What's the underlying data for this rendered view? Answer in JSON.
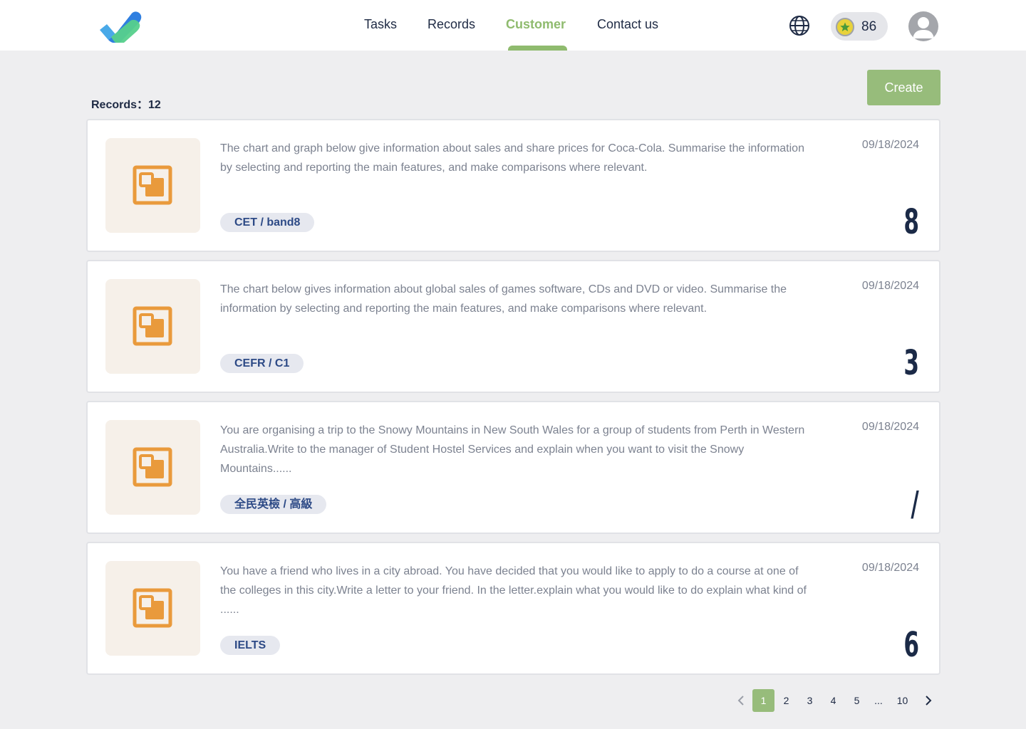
{
  "header": {
    "nav": [
      {
        "label": "Tasks",
        "active": false
      },
      {
        "label": "Records",
        "active": false
      },
      {
        "label": "Customer",
        "active": true
      },
      {
        "label": "Contact us",
        "active": false
      }
    ],
    "coins": "86"
  },
  "toolbar": {
    "records_label": "Records：12",
    "create_label": "Create"
  },
  "records": [
    {
      "description": "The chart and graph below give information about sales and share prices for Coca-Cola. Summarise the information by selecting and reporting the main features, and make comparisons where relevant.",
      "tag": "CET / band8",
      "date": "09/18/2024",
      "score": "8"
    },
    {
      "description": "The chart below gives information about global sales of games software, CDs and DVD or video. Summarise the information by selecting and reporting the main features, and make comparisons where relevant.",
      "tag": "CEFR / C1",
      "date": "09/18/2024",
      "score": "3"
    },
    {
      "description": "You are organising a trip to the Snowy Mountains in New South Wales for a group of students from Perth in Western Australia.Write to the manager of Student Hostel Services and explain when you want to visit the Snowy Mountains......",
      "tag": "全民英檢 / 高級",
      "date": "09/18/2024",
      "score": "/"
    },
    {
      "description": "You have a friend who lives in a city abroad. You have decided that you would like to apply to do a course at one of the colleges in this city.Write a letter to your friend. In the letter.explain what you would like to do explain what kind of ......",
      "tag": "IELTS",
      "date": "09/18/2024",
      "score": "6"
    }
  ],
  "pagination": {
    "pages": [
      "1",
      "2",
      "3",
      "4",
      "5"
    ],
    "ellipsis": "...",
    "last": "10",
    "current": "1"
  },
  "colors": {
    "accent": "#97bc7b",
    "active_nav": "#8fbb6e",
    "thumb_icon": "#e99a3c",
    "tag_text": "#2d4a86"
  }
}
